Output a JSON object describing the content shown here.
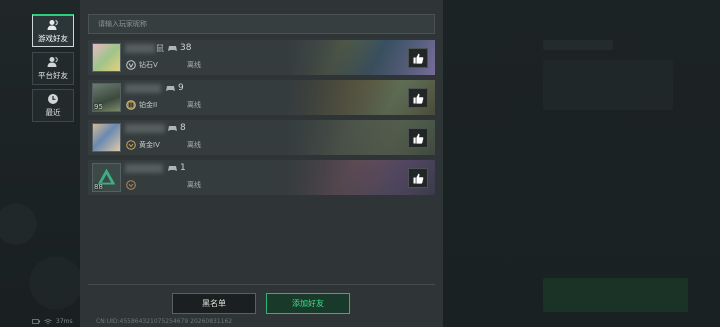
{
  "tabs": [
    {
      "label": "游戏好友",
      "icon": "users-icon",
      "active": true
    },
    {
      "label": "平台好友",
      "icon": "user-group-icon",
      "active": false
    },
    {
      "label": "最近",
      "icon": "clock-icon",
      "active": false
    }
  ],
  "search": {
    "placeholder": "请输入玩家昵称"
  },
  "friends": [
    {
      "name_fragment": "鼠",
      "count": "38",
      "rank": "钻石V",
      "status": "离线",
      "level": ""
    },
    {
      "name_fragment": "",
      "count": "9",
      "rank": "铂金II",
      "status": "离线",
      "level": "95"
    },
    {
      "name_fragment": "",
      "count": "8",
      "rank": "黄金IV",
      "status": "离线",
      "level": ""
    },
    {
      "name_fragment": "",
      "count": "1",
      "rank": "",
      "status": "离线",
      "level": "88"
    }
  ],
  "buttons": {
    "blacklist": "黑名单",
    "add_friend": "添加好友"
  },
  "footer": {
    "ping": "37ms",
    "uid": "CN:UID:455864321075254679 20260831162"
  },
  "colors": {
    "accent": "#2bd07d",
    "panel": "#2f3537",
    "row": "#353c3e"
  }
}
